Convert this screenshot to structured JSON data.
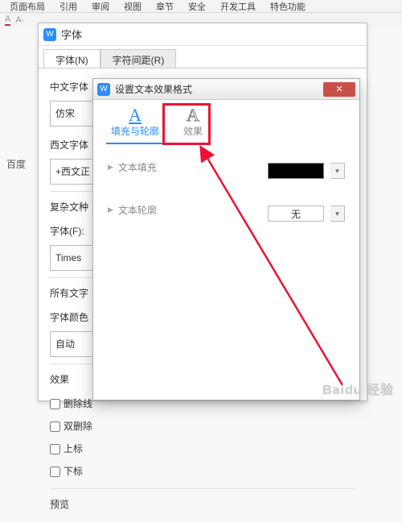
{
  "ribbon": {
    "items": [
      "页面布局",
      "引用",
      "审阅",
      "视图",
      "章节",
      "安全",
      "开发工具",
      "特色功能"
    ]
  },
  "toolbar_hint": "A·",
  "font_dialog": {
    "title": "字体",
    "tabs": {
      "font": "字体(N)",
      "spacing": "字符间距(R)"
    },
    "cn_font_label": "中文字体",
    "cn_font_value": "仿宋",
    "west_font_label": "西文字体",
    "west_font_value": "+西文正",
    "complex_label": "复杂文种",
    "font_label": "字体(F):",
    "font_value": "Times",
    "all_text_label": "所有文字",
    "font_color_label": "字体颜色",
    "auto_value": "自动",
    "effects_label": "效果",
    "chk_strike": "删除线",
    "chk_dblstrike": "双删除",
    "chk_superscript": "上标",
    "chk_subscript": "下标",
    "preview_label": "预览"
  },
  "textfx_dialog": {
    "title": "设置文本效果格式",
    "tab_fill": "填充与轮廓",
    "tab_fx": "效果",
    "section_fill": "文本填充",
    "section_outline": "文本轮廓",
    "outline_none": "无"
  },
  "side_text": "百度",
  "watermark": "Baidu 经验"
}
